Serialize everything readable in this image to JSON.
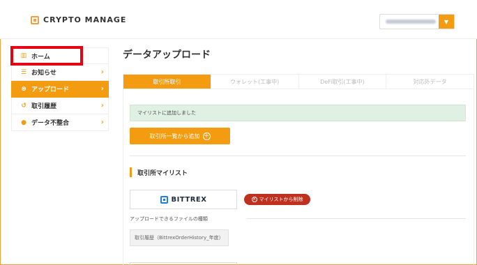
{
  "brand": {
    "name": "CRYPTO MANAGE"
  },
  "header": {
    "account_dropdown_icon": "caret-down-icon"
  },
  "sidebar": {
    "items": [
      {
        "label": "ホーム",
        "icon": "chart-bar-icon",
        "glyph": "▥"
      },
      {
        "label": "お知らせ",
        "icon": "list-icon",
        "glyph": "☰"
      },
      {
        "label": "アップロード",
        "icon": "upload-icon",
        "glyph": "⊛"
      },
      {
        "label": "取引履歴",
        "icon": "history-icon",
        "glyph": "↺"
      },
      {
        "label": "データ不整合",
        "icon": "alert-icon",
        "glyph": "●"
      }
    ],
    "active_index": 2
  },
  "main": {
    "title": "データアップロード",
    "tabs": [
      {
        "label": "取引所取引"
      },
      {
        "label": "ウォレット(工事中)"
      },
      {
        "label": "DeFi取引(工事中)"
      },
      {
        "label": "対応外データ"
      }
    ],
    "alert": "マイリストに追加しました",
    "add_button": "取引所一覧から追加",
    "section_title": "取引所マイリスト",
    "exchange": {
      "name": "BITTREX"
    },
    "remove_button": "マイリストから削除",
    "file_type_label": "アップロードできるファイルの種類",
    "file_type_value": "取引履歴（BittrexOrderHistory_年度）"
  },
  "colors": {
    "accent": "#f39c12",
    "alert_bg": "#e0f1e4",
    "remove": "#c0301f",
    "highlight": "#e60012",
    "brand_blue": "#1e7fd6"
  }
}
